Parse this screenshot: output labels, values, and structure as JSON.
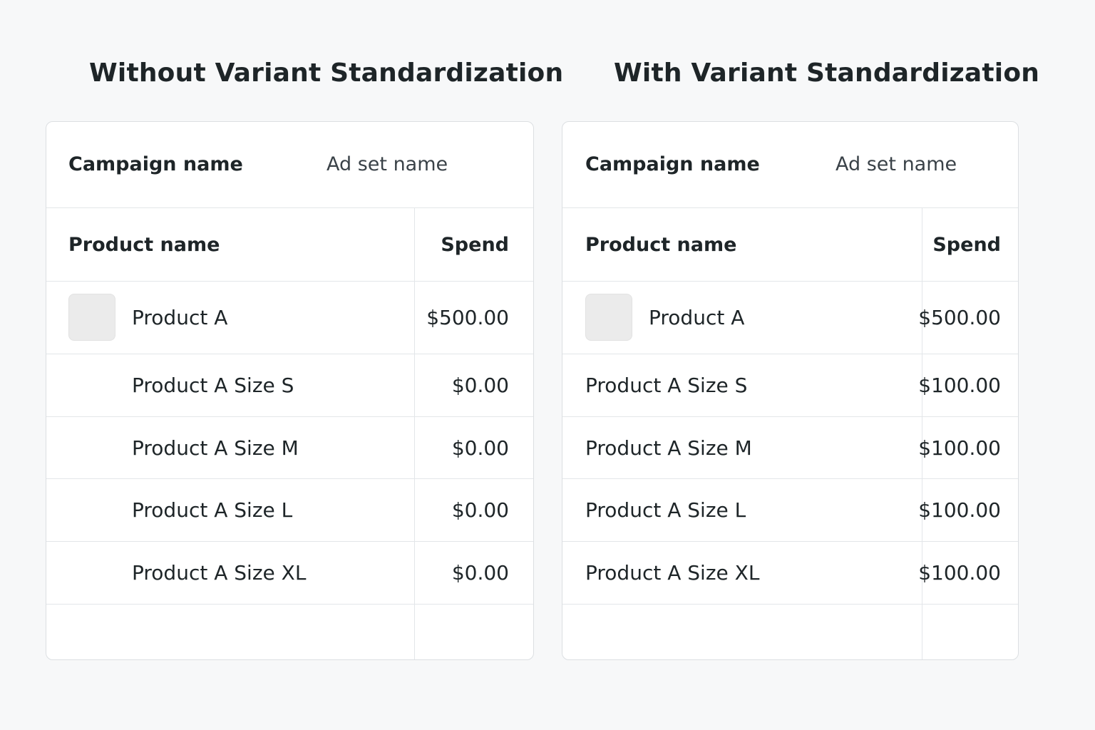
{
  "panels": [
    {
      "title": "Without Variant Standardization",
      "campaign_label": "Campaign name",
      "adset_label": "Ad set name",
      "columns": {
        "product": "Product name",
        "spend": "Spend"
      },
      "rows": [
        {
          "product": "Product A",
          "spend": "$500.00"
        },
        {
          "product": "Product A Size S",
          "spend": "$0.00"
        },
        {
          "product": "Product A Size M",
          "spend": "$0.00"
        },
        {
          "product": "Product A Size L",
          "spend": "$0.00"
        },
        {
          "product": "Product A Size XL",
          "spend": "$0.00"
        }
      ]
    },
    {
      "title": "With Variant Standardization",
      "campaign_label": "Campaign name",
      "adset_label": "Ad set name",
      "columns": {
        "product": "Product name",
        "spend": "Spend"
      },
      "rows": [
        {
          "product": "Product A",
          "spend": "$500.00"
        },
        {
          "product": "Product A Size S",
          "spend": "$100.00"
        },
        {
          "product": "Product A Size M",
          "spend": "$100.00"
        },
        {
          "product": "Product A Size L",
          "spend": "$100.00"
        },
        {
          "product": "Product A Size XL",
          "spend": "$100.00"
        }
      ]
    }
  ]
}
